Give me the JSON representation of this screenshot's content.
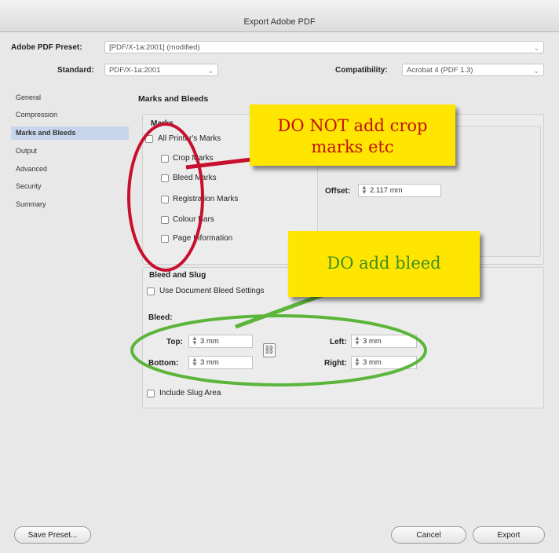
{
  "window": {
    "title": "Export Adobe PDF"
  },
  "preset": {
    "label": "Adobe PDF Preset:",
    "value": "[PDF/X-1a:2001] (modified)"
  },
  "standard": {
    "label": "Standard:",
    "value": "PDF/X-1a:2001"
  },
  "compatibility": {
    "label": "Compatibility:",
    "value": "Acrobat 4 (PDF 1.3)"
  },
  "sidebar": {
    "items": [
      {
        "label": "General"
      },
      {
        "label": "Compression"
      },
      {
        "label": "Marks and Bleeds"
      },
      {
        "label": "Output"
      },
      {
        "label": "Advanced"
      },
      {
        "label": "Security"
      },
      {
        "label": "Summary"
      }
    ],
    "active_index": 2
  },
  "content": {
    "section_title": "Marks and Bleeds"
  },
  "marks": {
    "group_label": "Marks",
    "all_printers": {
      "label": "All Printer's Marks",
      "checked": false
    },
    "items": [
      {
        "label": "Crop Marks",
        "checked": false
      },
      {
        "label": "Bleed Marks",
        "checked": false
      },
      {
        "label": "Registration Marks",
        "checked": false
      },
      {
        "label": "Colour Bars",
        "checked": false
      },
      {
        "label": "Page Information",
        "checked": false
      }
    ],
    "offset_label": "Offset:",
    "offset_value": "2.117 mm"
  },
  "bleed_slug": {
    "group_label": "Bleed and Slug",
    "use_document": {
      "label": "Use Document Bleed Settings",
      "checked": false
    },
    "bleed_label": "Bleed:",
    "top": {
      "label": "Top:",
      "value": "3 mm"
    },
    "bottom": {
      "label": "Bottom:",
      "value": "3 mm"
    },
    "left": {
      "label": "Left:",
      "value": "3 mm"
    },
    "right": {
      "label": "Right:",
      "value": "3 mm"
    },
    "include_slug": {
      "label": "Include Slug Area",
      "checked": false
    }
  },
  "buttons": {
    "save_preset": "Save Preset...",
    "cancel": "Cancel",
    "export": "Export"
  },
  "annotations": {
    "no_marks": "DO NOT add crop marks etc",
    "add_bleed": "DO add bleed",
    "red_color": "#c8102e",
    "green_color": "#5bb53a",
    "note_bg": "#ffe600"
  },
  "icons": {
    "link": "chain-link-icon",
    "spin": "stepper-arrows-icon",
    "dropdown": "chevron-down-icon"
  }
}
